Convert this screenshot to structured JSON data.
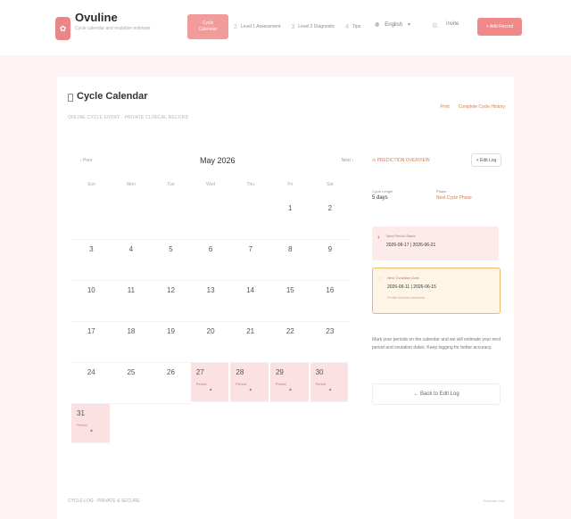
{
  "brand": {
    "name": "Ovuline",
    "tagline": "Cycle calendar and ovulation estimate"
  },
  "steps": [
    {
      "num": "1",
      "label": "Cycle Calendar",
      "active": true
    },
    {
      "num": "2",
      "label": "Level 1 Assessment",
      "active": false
    },
    {
      "num": "3",
      "label": "Level 2 Diagnostic",
      "active": false
    },
    {
      "num": "4",
      "label": "Tips",
      "active": false
    }
  ],
  "header": {
    "language": "English",
    "invite_label": "Invite",
    "primary_button": "+ Add Record"
  },
  "page": {
    "title": "Cycle Calendar",
    "subtitle": "ONLINE CYCLE ENTRY · PRIVATE CLINICAL RECORD",
    "link_print": "Print",
    "link_history": "Complete Cycle History"
  },
  "calendar": {
    "prev_label": "‹ Prev",
    "month_label": "May 2026",
    "next_label": "Next ›",
    "weekdays": [
      "Sun",
      "Mon",
      "Tue",
      "Wed",
      "Thu",
      "Fri",
      "Sat"
    ],
    "cells": [
      {
        "day": ""
      },
      {
        "day": ""
      },
      {
        "day": ""
      },
      {
        "day": ""
      },
      {
        "day": ""
      },
      {
        "day": "1"
      },
      {
        "day": "2"
      },
      {
        "day": "3"
      },
      {
        "day": "4"
      },
      {
        "day": "5"
      },
      {
        "day": "6"
      },
      {
        "day": "7"
      },
      {
        "day": "8"
      },
      {
        "day": "9"
      },
      {
        "day": "10"
      },
      {
        "day": "11"
      },
      {
        "day": "12"
      },
      {
        "day": "13"
      },
      {
        "day": "14"
      },
      {
        "day": "15"
      },
      {
        "day": "16"
      },
      {
        "day": "17"
      },
      {
        "day": "18"
      },
      {
        "day": "19"
      },
      {
        "day": "20"
      },
      {
        "day": "21"
      },
      {
        "day": "22"
      },
      {
        "day": "23"
      },
      {
        "day": "24"
      },
      {
        "day": "25"
      },
      {
        "day": "26"
      },
      {
        "day": "27",
        "tag": "Period",
        "marker": "▲"
      },
      {
        "day": "28",
        "tag": "Period",
        "marker": "▲"
      },
      {
        "day": "29",
        "tag": "Period",
        "marker": "▲"
      },
      {
        "day": "30",
        "tag": "Period",
        "marker": "▲"
      },
      {
        "day": "31",
        "tag": "Period",
        "marker": "▲"
      }
    ]
  },
  "side": {
    "prediction_link": "⊙ PREDICTION OVERVIEW",
    "edit_label": "+ Edit Log",
    "cycle_length_label": "Cycle Length",
    "cycle_length_value": "5 days",
    "phase_label": "Phase",
    "phase_value": "Next Cycle Phase",
    "next_period_label": "Next Period Starts",
    "next_period_value": "2026-06-17 | 2026-06-21",
    "ovulation_label": "Next Ovulation Date",
    "ovulation_value": "2026-06-11 | 2026-06-15",
    "ovulation_note": "Fertile window estimate",
    "note": "Mark your periods on the calendar and we will estimate your next period and ovulation dates. Keep logging for better accuracy.",
    "back_label": "← Back to Edit Log"
  },
  "footer": {
    "left": "CYCLE LOG · PRIVATE & SECURE",
    "right": "Estimate only"
  }
}
